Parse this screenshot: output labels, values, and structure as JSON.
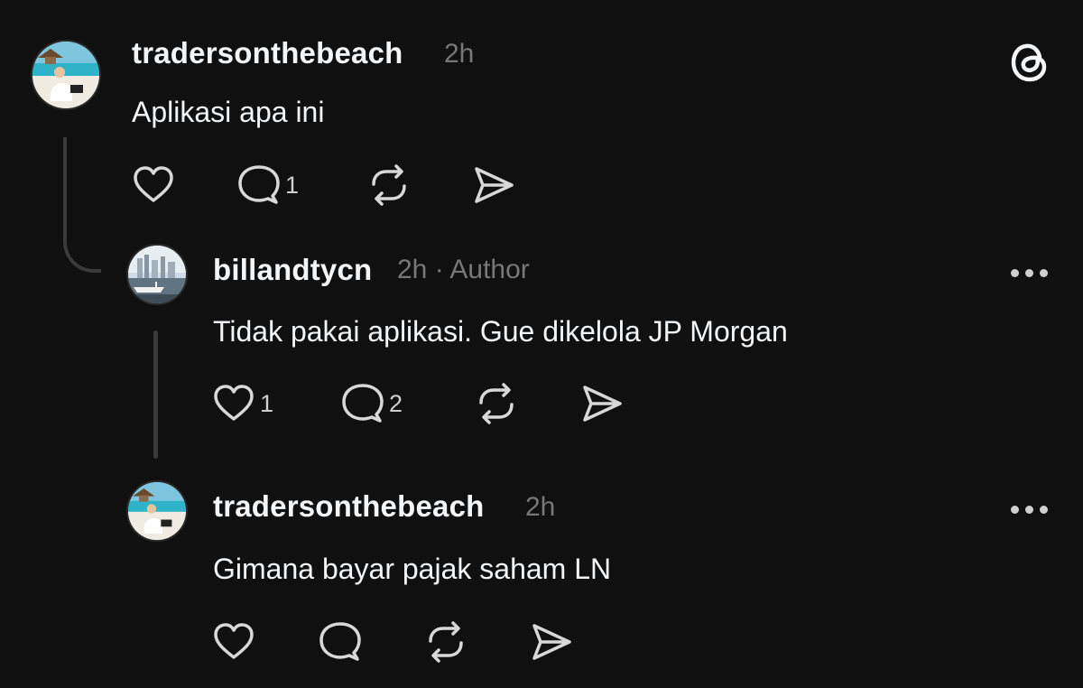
{
  "app": {
    "logo_icon": "threads-logo-icon",
    "accent": "#f3f5f7",
    "background": "#101010",
    "muted": "#777777"
  },
  "posts": [
    {
      "username": "tradersonthebeach",
      "time": "2h",
      "text": "Aplikasi apa ini",
      "avatar_icon": "beach-avatar",
      "actions": {
        "like_count": "",
        "comment_count": "1",
        "repost_count": "",
        "share_count": ""
      }
    },
    {
      "username": "billandtycn",
      "time": "2h",
      "separator": "·",
      "role": "Author",
      "text": "Tidak pakai aplikasi. Gue dikelola JP Morgan",
      "avatar_icon": "marina-avatar",
      "actions": {
        "like_count": "1",
        "comment_count": "2",
        "repost_count": "",
        "share_count": ""
      }
    },
    {
      "username": "tradersonthebeach",
      "time": "2h",
      "text": "Gimana bayar pajak saham LN",
      "avatar_icon": "beach-avatar",
      "actions": {
        "like_count": "",
        "comment_count": "",
        "repost_count": "",
        "share_count": ""
      }
    }
  ]
}
